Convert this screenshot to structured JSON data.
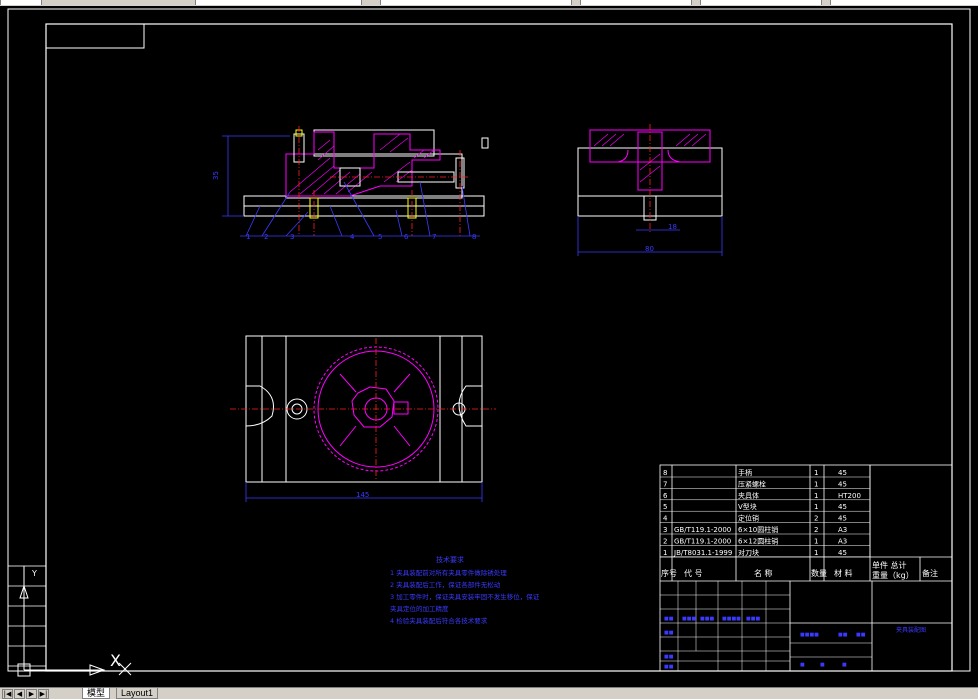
{
  "tabs": [
    {
      "label": "模型",
      "active": true
    },
    {
      "label": "Layout1",
      "active": false
    }
  ],
  "dims": {
    "height": "35",
    "front_width": "145",
    "side_width": "80",
    "side_detail": "18"
  },
  "balloons": [
    "1",
    "2",
    "3",
    "4",
    "5",
    "6",
    "7",
    "8"
  ],
  "notes": {
    "title": "技术要求",
    "items": [
      "1  夹具装配前对所有夹具零件做除锈处理",
      "2  夹具装配后工作，保证各部件无松动",
      "3  加工零件时，保证夹具安装牢固不发生移位，保证",
      "   夹具定位的加工精度",
      "4  检验夹具装配后符合各技术要求"
    ]
  },
  "bom": {
    "rows": [
      {
        "no": "8",
        "code": "",
        "name": "手柄",
        "qty": "1",
        "material": "45"
      },
      {
        "no": "7",
        "code": "",
        "name": "压紧螺栓",
        "qty": "1",
        "material": "45"
      },
      {
        "no": "6",
        "code": "",
        "name": "夹具体",
        "qty": "1",
        "material": "HT200"
      },
      {
        "no": "5",
        "code": "",
        "name": "V型块",
        "qty": "1",
        "material": "45"
      },
      {
        "no": "4",
        "code": "",
        "name": "定位销",
        "qty": "2",
        "material": "45"
      },
      {
        "no": "3",
        "code": "GB/T119.1-2000",
        "name": "6×10圆柱销",
        "qty": "2",
        "material": "A3"
      },
      {
        "no": "2",
        "code": "GB/T119.1-2000",
        "name": "6×12圆柱销",
        "qty": "1",
        "material": "A3"
      },
      {
        "no": "1",
        "code": "JB/T8031.1-1999",
        "name": "对刀块",
        "qty": "1",
        "material": "45"
      }
    ],
    "header": {
      "no": "序号",
      "code": "代 号",
      "name": "名 称",
      "qty": "数量",
      "material": "材 料",
      "weight": "单件 总计",
      "weight2": "重量（kg）",
      "remark": "备注"
    },
    "title_block_name": "夹具装配图"
  },
  "colors": {
    "bg": "#000000",
    "lines": "#ffffff",
    "dim": "#3a3aff",
    "section": "#ff00ff",
    "center": "#ff2020",
    "axis": "#ffffff"
  },
  "ucs": {
    "y_label": "Y",
    "x_label": "X"
  }
}
